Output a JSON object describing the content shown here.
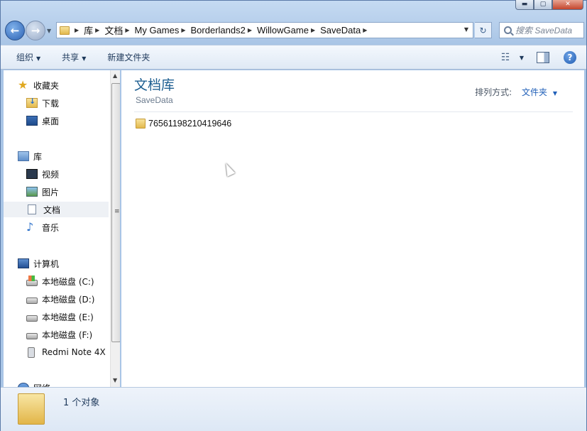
{
  "window": {
    "min_glyph": "▬",
    "max_glyph": "▢",
    "close_glyph": "✕"
  },
  "nav": {
    "back_glyph": "←",
    "forward_glyph": "→"
  },
  "address": {
    "crumbs": [
      "库",
      "文档",
      "My Games",
      "Borderlands2",
      "WillowGame",
      "SaveData"
    ],
    "refresh_glyph": "↻"
  },
  "search": {
    "placeholder": "搜索 SaveData"
  },
  "toolbar": {
    "organize_label": "组织",
    "share_label": "共享",
    "new_folder_label": "新建文件夹",
    "help_label": "?"
  },
  "sidebar": {
    "favorites": {
      "label": "收藏夹",
      "items": [
        {
          "label": "下载",
          "icon": "download-icon"
        },
        {
          "label": "桌面",
          "icon": "desktop-icon"
        }
      ]
    },
    "libraries": {
      "label": "库",
      "items": [
        {
          "label": "视频",
          "icon": "video-icon"
        },
        {
          "label": "图片",
          "icon": "picture-icon"
        },
        {
          "label": "文档",
          "icon": "document-icon",
          "selected": true
        },
        {
          "label": "音乐",
          "icon": "music-icon"
        }
      ]
    },
    "computer": {
      "label": "计算机",
      "items": [
        {
          "label": "本地磁盘 (C:)",
          "icon": "system-drive-icon"
        },
        {
          "label": "本地磁盘 (D:)",
          "icon": "drive-icon"
        },
        {
          "label": "本地磁盘 (E:)",
          "icon": "drive-icon"
        },
        {
          "label": "本地磁盘 (F:)",
          "icon": "drive-icon"
        },
        {
          "label": "Redmi Note 4X",
          "icon": "phone-icon"
        }
      ]
    },
    "network": {
      "label": "网络"
    }
  },
  "content": {
    "library_title": "文档库",
    "library_subtitle": "SaveData",
    "arrange_label": "排列方式:",
    "arrange_value": "文件夹",
    "files": [
      {
        "name": "76561198210419646",
        "type": "folder"
      }
    ]
  },
  "details": {
    "summary": "1 个对象"
  }
}
